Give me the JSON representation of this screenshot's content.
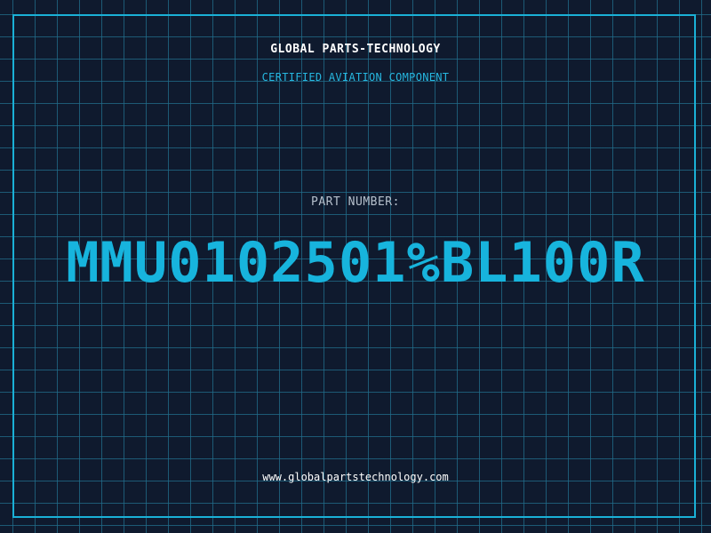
{
  "header": {
    "company": "GLOBAL PARTS-TECHNOLOGY",
    "tagline": "CERTIFIED AVIATION COMPONENT"
  },
  "part": {
    "label": "PART NUMBER:",
    "number": "MMU0102501%BL100R"
  },
  "footer": {
    "website": "www.globalpartstechnology.com"
  },
  "colors": {
    "background": "#0f1a2e",
    "grid": "#216e8c",
    "accent": "#17b4dd",
    "text": "#ffffff",
    "muted": "#b6c0cc"
  }
}
